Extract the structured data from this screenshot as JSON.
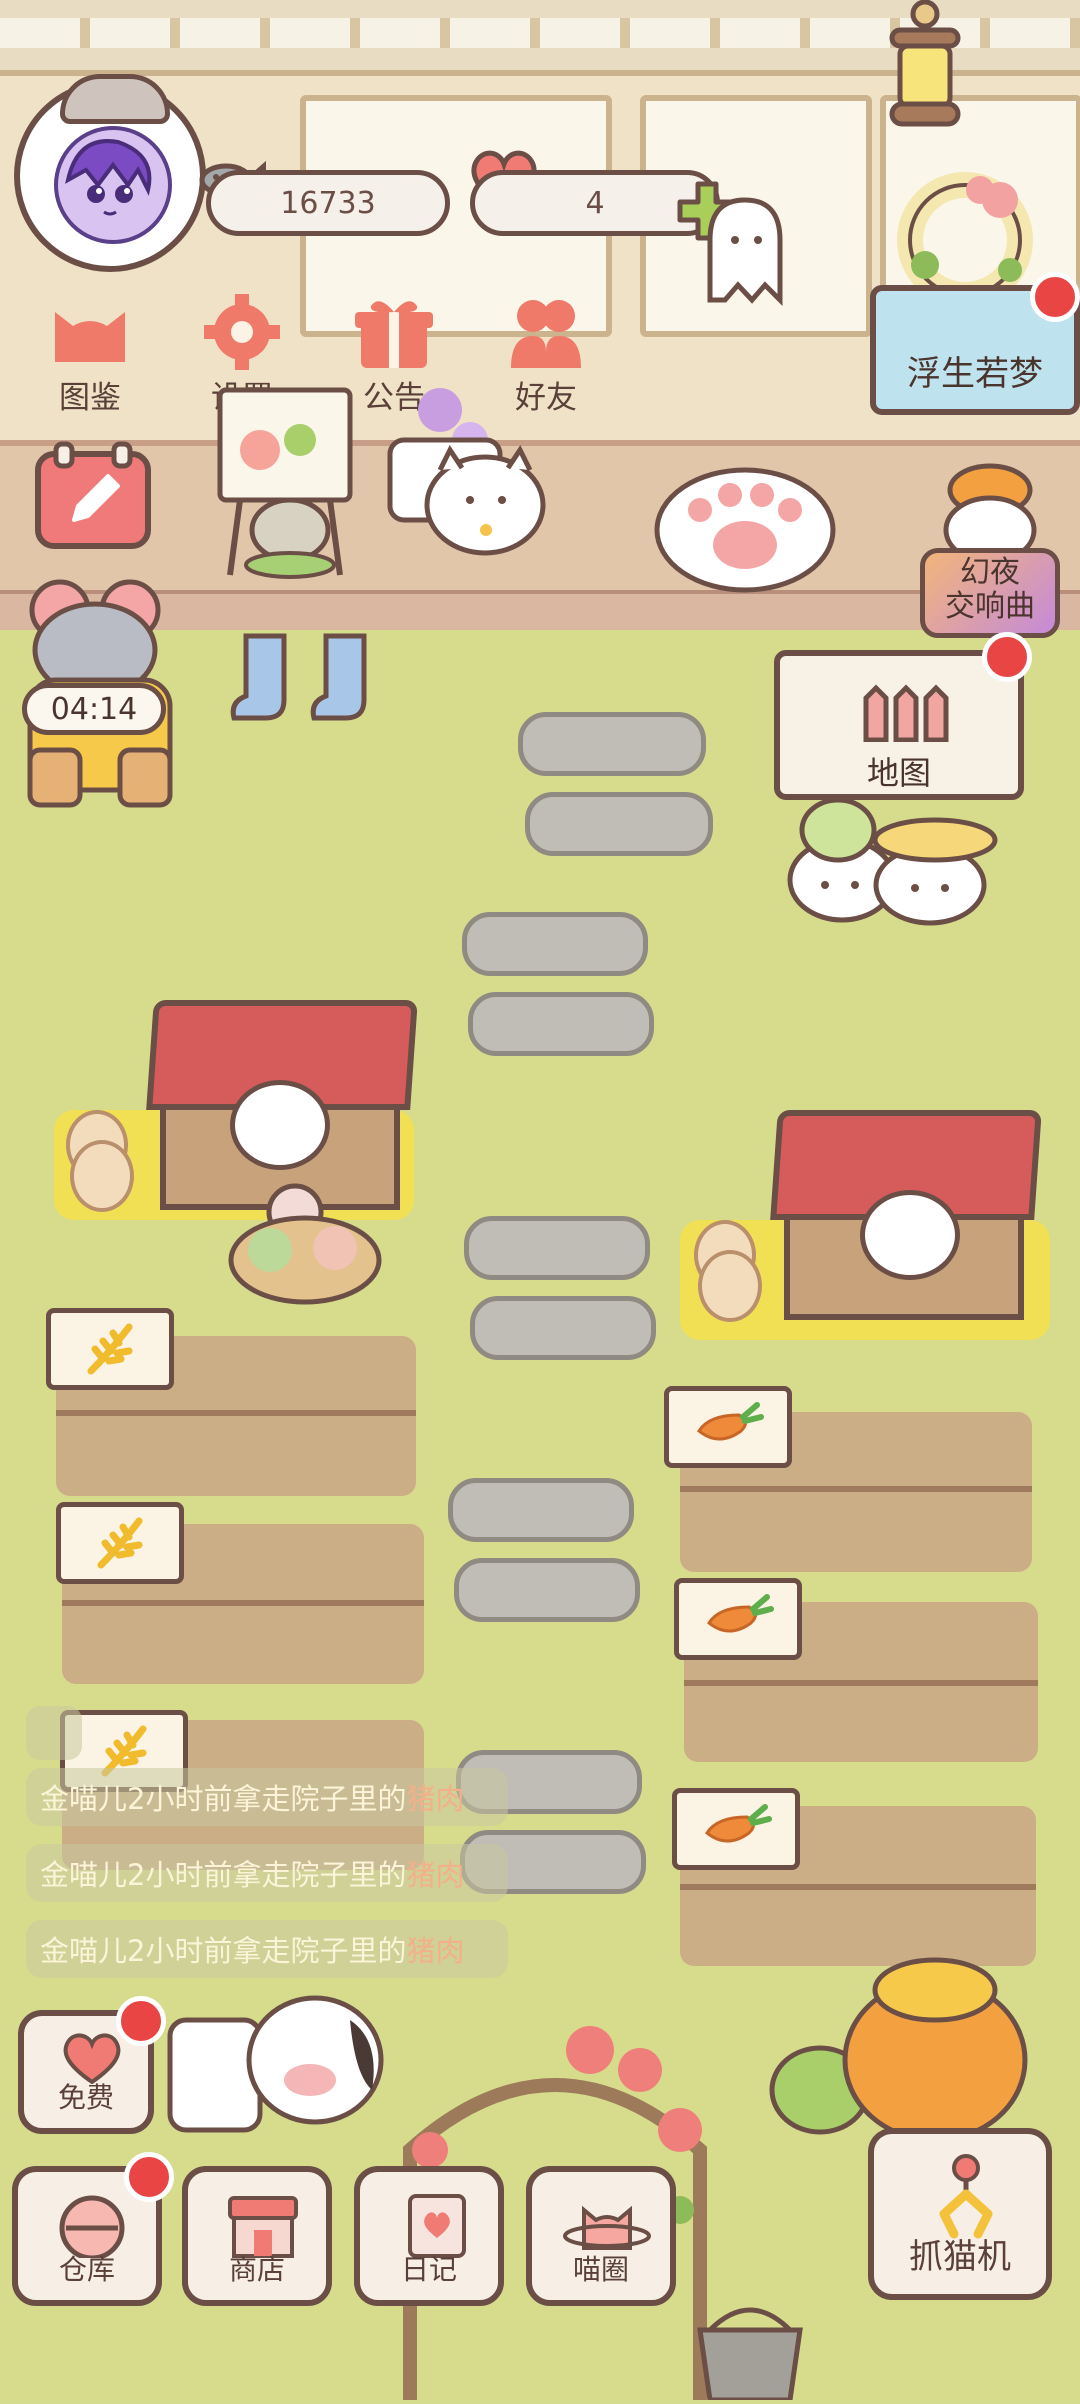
{
  "top_bar": {
    "fish_count": "16733",
    "heart_count": "4"
  },
  "menu": {
    "catalog": "图鉴",
    "settings": "设置",
    "announcement": "公告",
    "friends": "好友"
  },
  "right_panel": {
    "event_banner": "浮生若梦",
    "phantom_event": "幻夜\n交响曲",
    "map": "地图"
  },
  "timer": "04:14",
  "chat": [
    {
      "prefix": "金喵儿2小时前拿走院子里的",
      "item": "猪肉"
    },
    {
      "prefix": "金喵儿2小时前拿走院子里的",
      "item": "猪肉"
    },
    {
      "prefix": "金喵儿2小时前拿走院子里的",
      "item": "猪肉"
    }
  ],
  "bottom_bar": {
    "free": "免费",
    "warehouse": "仓库",
    "shop": "商店",
    "diary": "日记",
    "cat_circle": "喵圈",
    "claw_machine": "抓猫机"
  },
  "colors": {
    "outline": "#6b4e46",
    "grass": "#d7dc8d",
    "badge_red": "#e94545",
    "roof_red": "#d65b5b",
    "soil": "#c9a585"
  },
  "icons": {
    "fish": "fish-icon",
    "heart": "heart-icon",
    "plus": "plus-icon",
    "catalog": "cat-head-icon",
    "settings": "gear-icon",
    "announcement": "gift-icon",
    "friends": "friends-icon",
    "edit": "pencil-icon",
    "map": "fence-icon"
  }
}
